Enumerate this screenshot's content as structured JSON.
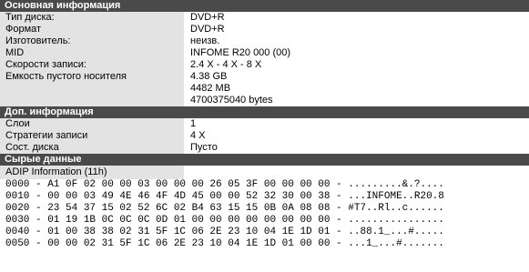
{
  "basic": {
    "header": "Основная информация",
    "rows": [
      {
        "label": "Тип диска:",
        "value": "DVD+R"
      },
      {
        "label": "Формат",
        "value": "DVD+R"
      },
      {
        "label": "Изготовитель:",
        "value": " неизв."
      },
      {
        "label": "MID",
        "value": "INFOME R20 000 (00)"
      },
      {
        "label": "Скорости записи:",
        "value": "2.4 X - 4 X - 8 X"
      },
      {
        "label": "Емкость пустого носителя",
        "value": "4.38 GB"
      },
      {
        "label": "",
        "value": "4482 MB"
      },
      {
        "label": "",
        "value": "4700375040 bytes"
      }
    ]
  },
  "extra": {
    "header": "Доп. информация",
    "rows": [
      {
        "label": "Слои",
        "value": "1"
      },
      {
        "label": "Стратегии записи",
        "value": "4 X"
      },
      {
        "label": "Сост. диска",
        "value": "Пусто"
      }
    ]
  },
  "raw": {
    "header": "Сырые данные",
    "title": "ADIP Information (11h)",
    "lines": [
      "0000 - A1 0F 02 00 00 03 00 00 00 26 05 3F 00 00 00 00 - .........&.?....",
      "0010 - 00 00 03 49 4E 46 4F 4D 45 00 00 52 32 30 00 38 - ...INFOME..R20.8",
      "0020 - 23 54 37 15 02 52 6C 02 B4 63 15 15 0B 0A 08 08 - #T7..Rl..c......",
      "0030 - 01 19 1B 0C 0C 0C 0D 01 00 00 00 00 00 00 00 00 - ................",
      "0040 - 01 00 38 38 02 31 5F 1C 06 2E 23 10 04 1E 1D 01 - ..88.1_...#.....",
      "0050 - 00 00 02 31 5F 1C 06 2E 23 10 04 1E 1D 01 00 00 - ...1_...#......."
    ]
  }
}
